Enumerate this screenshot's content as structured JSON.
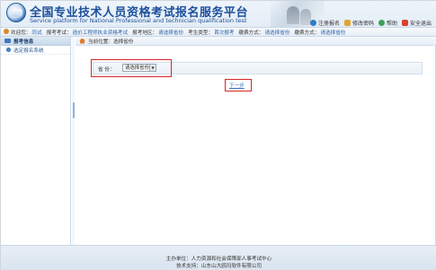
{
  "header": {
    "title_cn": "全国专业技术人员资格考试报名服务平台",
    "title_en": "Service platform for National Professional and technician qualification test",
    "links": [
      {
        "label": "注册报名",
        "icon": "globe-icon"
      },
      {
        "label": "修改密码",
        "icon": "key-icon"
      },
      {
        "label": "帮助",
        "icon": "help-icon"
      },
      {
        "label": "安全退出",
        "icon": "exit-icon"
      }
    ]
  },
  "infobar": {
    "welcome_label": "欢迎您：",
    "welcome_value": "同试",
    "exam_label": "报考考试：",
    "exam_value": "造价工程师执业资格考试",
    "region_label": "报考地区：",
    "region_value": "请选择省份",
    "type_label": "考生类型：",
    "type_value": "首次报考",
    "contact_label": "缴费方式：",
    "contact_value": "请选择省份",
    "fee_label": "缴费方式：",
    "fee_value": "请选择省份"
  },
  "sidebar": {
    "header": "报考信息",
    "items": [
      {
        "label": "选定报名系统"
      }
    ]
  },
  "main": {
    "breadcrumb": "当前位置：选择省份",
    "form": {
      "label": "省 份：",
      "select_value": "请选择省份",
      "arrow": "▼"
    },
    "next_button": "下一步"
  },
  "footer": {
    "line1": "主办单位：人力资源和社会保障部人事考试中心",
    "line2": "技术支持：山东山大鸥玛软件有限公司"
  }
}
